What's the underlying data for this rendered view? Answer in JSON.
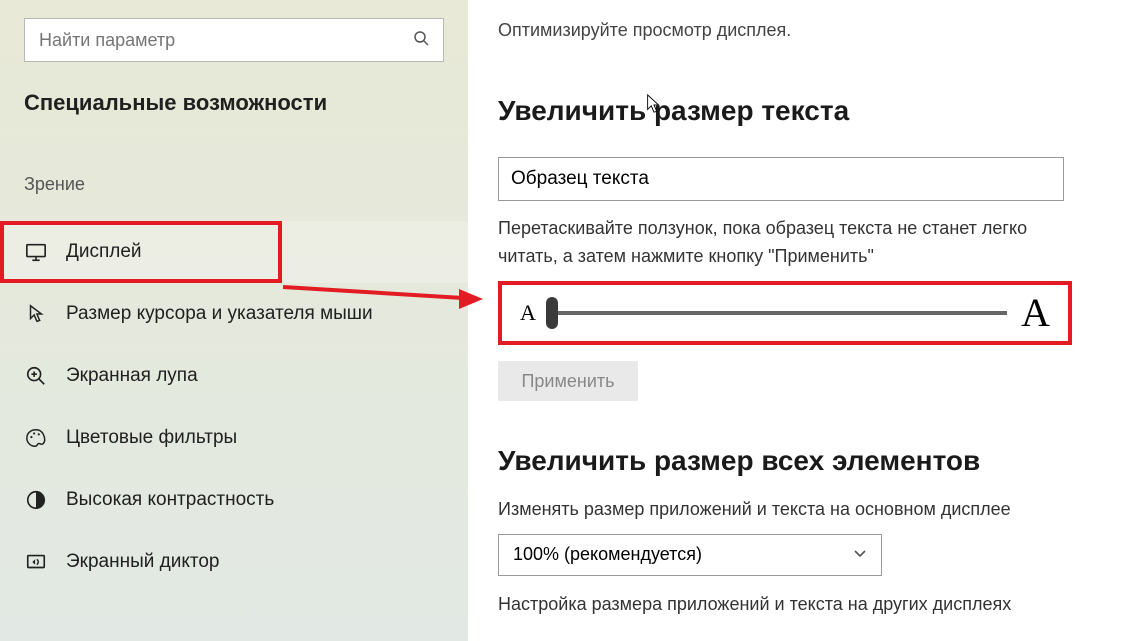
{
  "sidebar": {
    "search_placeholder": "Найти параметр",
    "title": "Специальные возможности",
    "group_label": "Зрение",
    "items": [
      {
        "label": "Дисплей"
      },
      {
        "label": "Размер курсора и указателя мыши"
      },
      {
        "label": "Экранная лупа"
      },
      {
        "label": "Цветовые фильтры"
      },
      {
        "label": "Высокая контрастность"
      },
      {
        "label": "Экранный диктор"
      }
    ]
  },
  "main": {
    "hint": "Оптимизируйте просмотр дисплея.",
    "section1_title": "Увеличить размер текста",
    "sample_text": "Образец текста",
    "slider_desc": "Перетаскивайте ползунок, пока образец текста не станет легко читать, а затем нажмите кнопку \"Применить\"",
    "slider_small": "A",
    "slider_large": "A",
    "apply_label": "Применить",
    "section2_title": "Увеличить размер всех элементов",
    "scale_desc": "Изменять размер приложений и текста на основном дисплее",
    "scale_value": "100% (рекомендуется)",
    "other_displays": "Настройка размера приложений и текста на других дисплеях"
  },
  "annotations": {
    "highlight_color": "#e31b23"
  }
}
